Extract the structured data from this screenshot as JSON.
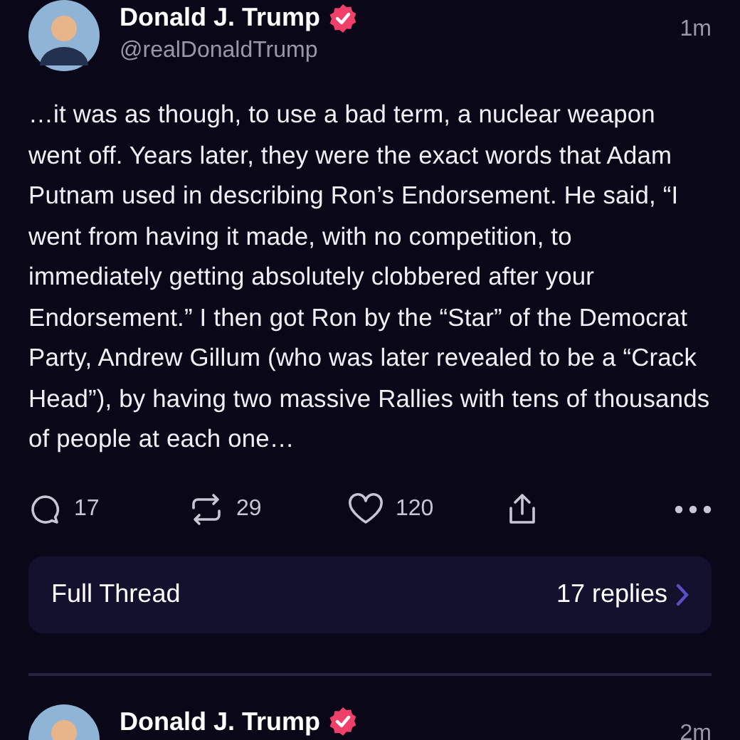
{
  "posts": [
    {
      "author": "Donald J. Trump",
      "verified": true,
      "handle": "@realDonaldTrump",
      "time": "1m",
      "text": "…it was as though, to use a bad term, a nuclear weapon went off. Years later, they were the exact words that Adam Putnam used in describing Ron’s Endorsement. He said, “I went from having it made, with no competition, to immediately getting absolutely clobbered after your Endorsement.” I then got Ron by the “Star” of the Democrat Party, Andrew Gillum (who was later revealed to be a “Crack Head”), by having two massive Rallies with tens of thousands of people at each one…",
      "actions": [
        {
          "kind": "reply",
          "count": "17"
        },
        {
          "kind": "repost",
          "count": "29"
        },
        {
          "kind": "like",
          "count": "120"
        },
        {
          "kind": "share"
        },
        {
          "kind": "more"
        }
      ],
      "thread": {
        "label": "Full Thread",
        "replies": "17 replies"
      }
    },
    {
      "author": "Donald J. Trump",
      "verified": true,
      "time": "2m"
    }
  ]
}
